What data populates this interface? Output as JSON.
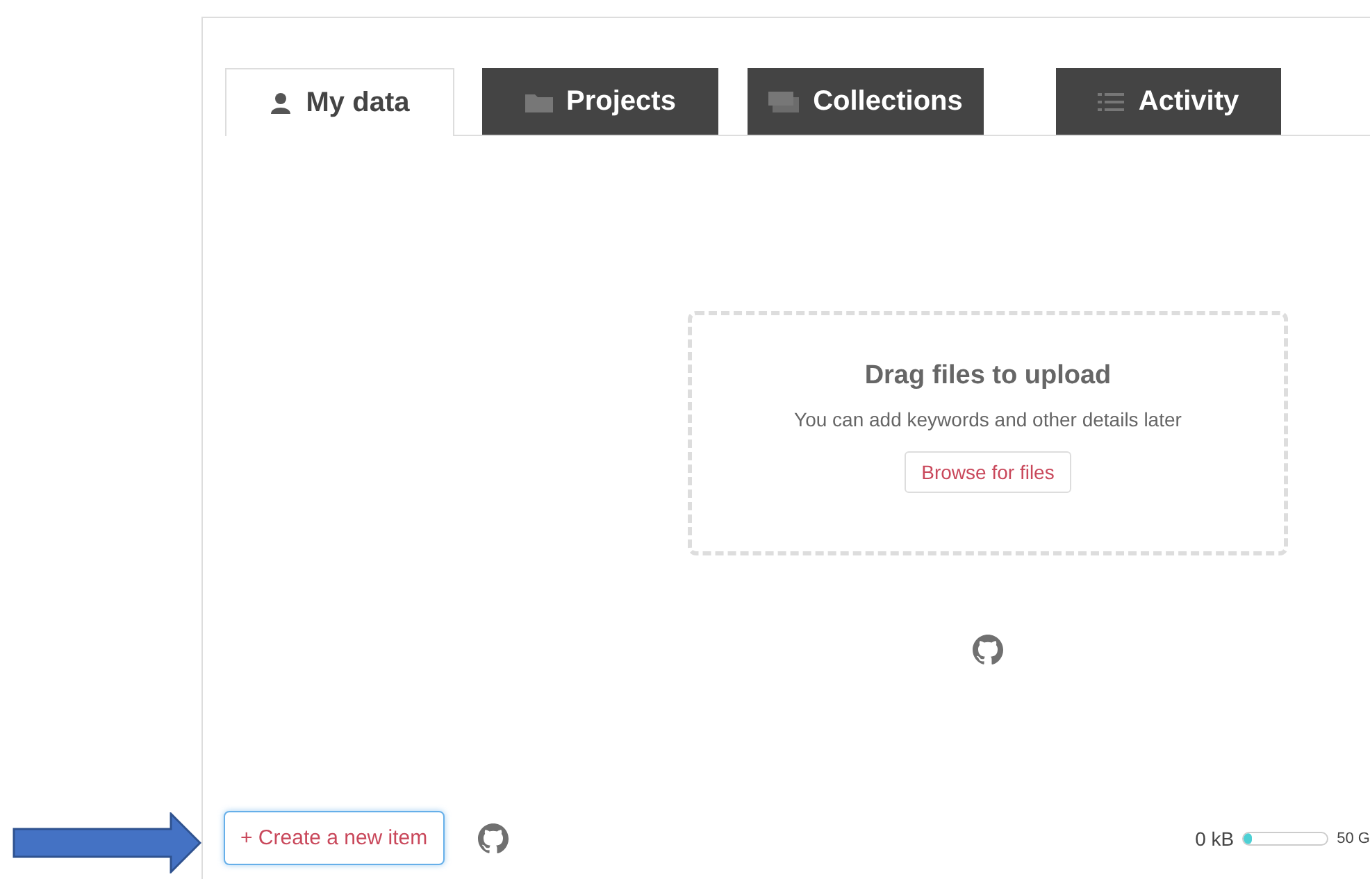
{
  "tabs": [
    {
      "label": "My data",
      "kind": "person",
      "selected": true
    },
    {
      "label": "Projects",
      "kind": "folder",
      "selected": false
    },
    {
      "label": "Collections",
      "kind": "stack",
      "selected": false
    },
    {
      "label": "Activity",
      "kind": "list",
      "selected": false
    }
  ],
  "upload": {
    "title": "Drag files to upload",
    "hint": "You can add keywords and other details later",
    "button": "Browse for files"
  },
  "footer": {
    "create_button": "+ Create a new item",
    "storage_used": "0 kB",
    "storage": {
      "level": 0.02
    },
    "storage_total": "50 G"
  }
}
